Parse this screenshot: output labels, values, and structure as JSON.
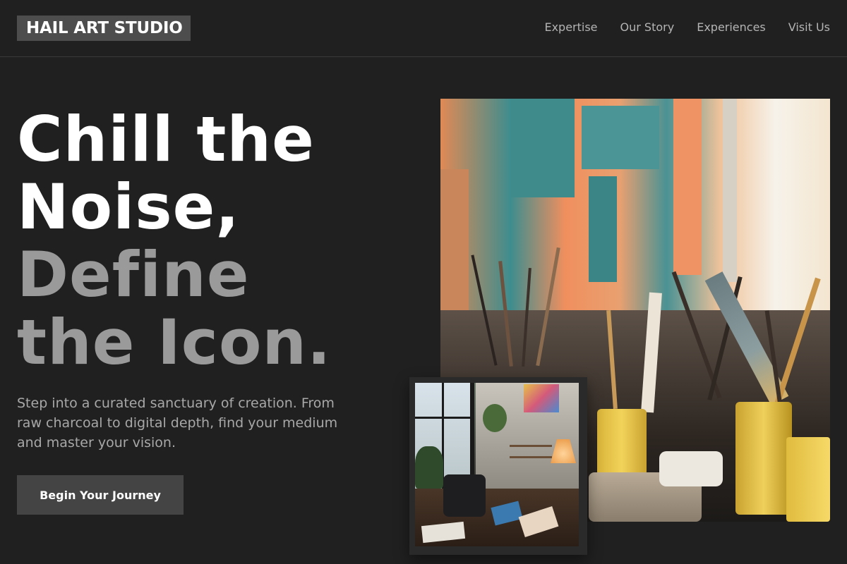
{
  "header": {
    "logo": "HAIL ART STUDIO",
    "nav": [
      "Expertise",
      "Our Story",
      "Experiences",
      "Visit Us"
    ]
  },
  "hero": {
    "headline_lines": [
      "Chill the",
      "Noise,",
      "Define",
      "the Icon."
    ],
    "subtext": "Step into a curated sanctuary of creation. From raw charcoal to digital depth, find your medium and master your vision.",
    "cta_label": "Begin Your Journey"
  },
  "colors": {
    "background": "#202020",
    "headline_primary": "#ffffff",
    "headline_secondary": "#9a9a9a",
    "button_bg": "#444444",
    "logo_bg": "#4d4d4d"
  },
  "images": {
    "main": "art-studio-paint-brushes-photo",
    "inset": "art-studio-workspace-photo"
  }
}
